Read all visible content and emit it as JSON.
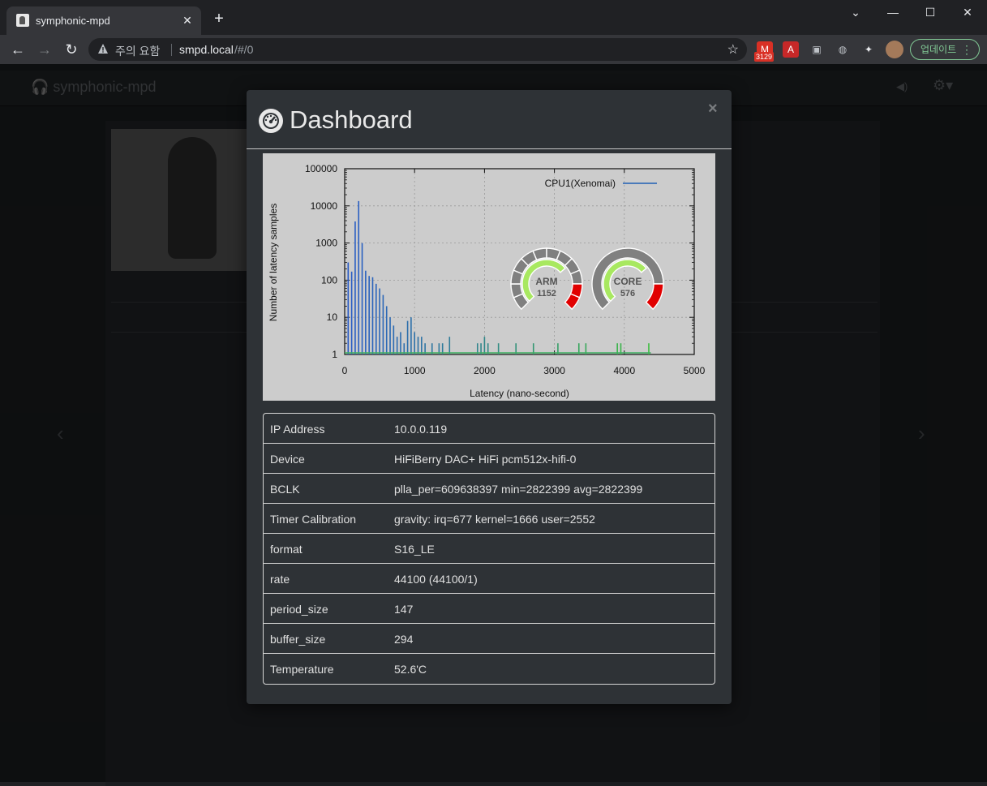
{
  "browser": {
    "tab_title": "symphonic-mpd",
    "tab_close": "✕",
    "new_tab": "+",
    "window_controls": {
      "minimize": "—",
      "maximize": "☐",
      "close": "✕",
      "tabsearch": "⌄"
    },
    "security_warning": "주의 요함",
    "url_host": "smpd.local",
    "url_path": "/#/0",
    "ext_badge": "3129",
    "update_label": "업데이트"
  },
  "app": {
    "brand": "symphonic-mpd"
  },
  "modal": {
    "title": "Dashboard",
    "close": "×"
  },
  "chart_data": {
    "type": "bar",
    "xlabel": "Latency (nano-second)",
    "ylabel": "Number of latency samples",
    "xlim": [
      0,
      5000
    ],
    "ylim": [
      1,
      100000
    ],
    "yscale": "log",
    "xticks": [
      "0",
      "1000",
      "2000",
      "3000",
      "4000",
      "5000"
    ],
    "yticks": [
      "1",
      "10",
      "100",
      "1000",
      "10000",
      "100000"
    ],
    "grid": true,
    "legend": "top-right",
    "series": [
      {
        "name": "CPU1(Xenomai)",
        "color": "#1f5fb4",
        "x": [
          50,
          100,
          150,
          200,
          250,
          300,
          350,
          400,
          450,
          500,
          550,
          600,
          650,
          700,
          750,
          800,
          850,
          900,
          950,
          1000,
          1050,
          1100,
          1150,
          1250,
          1350,
          1400,
          1500,
          1900,
          1950,
          2000,
          2050,
          2200,
          2450,
          2700,
          3050,
          3350,
          3450,
          3900,
          3950,
          4350
        ],
        "values": [
          300,
          170,
          3800,
          13500,
          1000,
          180,
          130,
          120,
          80,
          60,
          40,
          20,
          10,
          6,
          3,
          4,
          2,
          8,
          10,
          4,
          3,
          3,
          2,
          2,
          2,
          2,
          3,
          2,
          2,
          3,
          2,
          2,
          2,
          2,
          2,
          2,
          2,
          2,
          2,
          2
        ]
      }
    ],
    "gauges": [
      {
        "label": "ARM",
        "value": 1152
      },
      {
        "label": "CORE",
        "value": 576
      }
    ]
  },
  "info": [
    {
      "key": "IP Address",
      "value": "10.0.0.119"
    },
    {
      "key": "Device",
      "value": "HiFiBerry DAC+ HiFi pcm512x-hifi-0"
    },
    {
      "key": "BCLK",
      "value": "plla_per=609638397 min=2822399 avg=2822399"
    },
    {
      "key": "Timer Calibration",
      "value": "gravity: irq=677 kernel=1666 user=2552"
    },
    {
      "key": "format",
      "value": "S16_LE"
    },
    {
      "key": "rate",
      "value": "44100 (44100/1)"
    },
    {
      "key": "period_size",
      "value": "147"
    },
    {
      "key": "buffer_size",
      "value": "294"
    },
    {
      "key": "Temperature",
      "value": "52.6'C"
    }
  ]
}
